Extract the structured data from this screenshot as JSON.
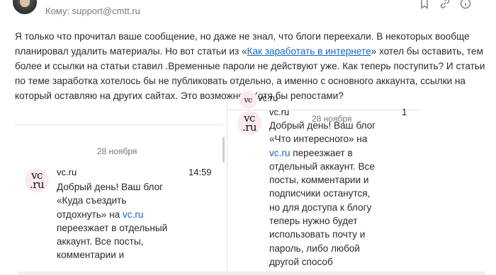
{
  "header": {
    "title": "...",
    "to_label": "Кому: support@cmtt.ru",
    "icons": [
      "bookmark-icon",
      "link-icon",
      "info-icon"
    ]
  },
  "message": {
    "part1": "Я только что прочитал ваше сообщение, но даже не знал, что блоги переехали. В некоторых вообще планировал удалить материалы. Но вот статьи из «",
    "link_text": "Как заработать в интернете",
    "part2": "» хотел бы оставить, тем более и ссылки на статьи ставил .Временные пароли не действуют уже. Как теперь поступить? И статьи по теме заработка хотелось бы не публиковать отдельно, а именно с основного аккаунта, ссылки на который оставляю на других сайтах. Это возможно? Хотя бы репостами?"
  },
  "quote_left": {
    "date": "28 ноября",
    "sender": "vc.ru",
    "time": "14:59",
    "logo_top": "vc",
    "logo_bottom": ".ru",
    "text_before": "Добрый день! Ваш блог «Куда съездить отдохнуть» на ",
    "link": "vc.ru",
    "text_after": " переезжает в отдельный аккаунт. Все посты, комментарии и"
  },
  "quote_right": {
    "date": "28 ноября",
    "sender": "vc.ru",
    "time_fragment": "1",
    "logo_top": "vc",
    "logo_bottom": ".ru",
    "text_before": "Добрый день! Ваш блог «Что интересного» на ",
    "link": "vc.ru",
    "text_after": " переезжает в отдельный аккаунт. Все посты, комментарии и подписчики останутся, но для доступа к блогу теперь нужно будет использовать почту и пароль, либо любой другой способ"
  }
}
